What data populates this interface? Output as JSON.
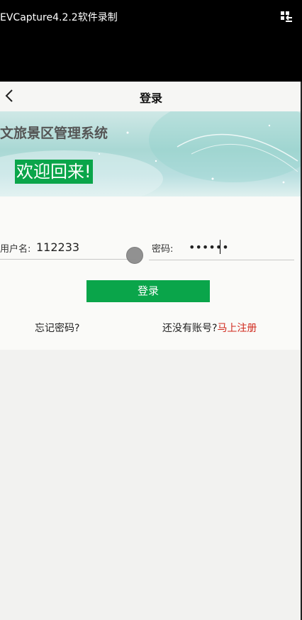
{
  "recorder": {
    "title": "EVCapture4.2.2软件录制",
    "menu_icon": "grid-arrow-icon"
  },
  "nav": {
    "back_icon": "chevron-left-icon",
    "title": "登录"
  },
  "banner": {
    "system_name": "文旅景区管理系统",
    "welcome": "欢迎回来!"
  },
  "form": {
    "username": {
      "label": "用户名:",
      "value": "112233"
    },
    "password": {
      "label": "密码:",
      "value": "••••••"
    },
    "login_button": "登录",
    "forgot_link": "忘记密码?",
    "register_prompt": "还没有账号?",
    "register_link": "马上注册"
  },
  "colors": {
    "accent_green": "#0aa54a",
    "register_red": "#d0281c"
  }
}
